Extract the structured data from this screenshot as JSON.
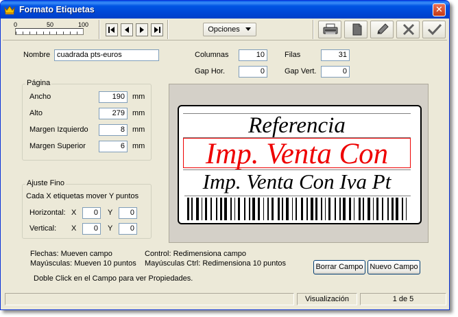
{
  "window": {
    "title": "Formato Etiquetas",
    "close_glyph": "✕",
    "app_icon": "crown-icon"
  },
  "toolbar": {
    "zoom_labels": [
      "0",
      "50",
      "100"
    ],
    "nav_icons": [
      "first-record-icon",
      "previous-record-icon",
      "next-record-icon",
      "last-record-icon"
    ],
    "options_label": "Opciones",
    "tool_icons": [
      "printer-icon",
      "copy-icon",
      "edit-pencil-icon",
      "delete-x-icon",
      "accept-check-icon"
    ]
  },
  "form": {
    "nombre_label": "Nombre",
    "nombre_value": "cuadrada pts-euros",
    "columnas_label": "Columnas",
    "columnas_value": "10",
    "filas_label": "Filas",
    "filas_value": "31",
    "gap_hor_label": "Gap Hor.",
    "gap_hor_value": "0",
    "gap_vert_label": "Gap Vert.",
    "gap_vert_value": "0"
  },
  "pagina": {
    "title": "Página",
    "unit": "mm",
    "rows": [
      {
        "label": "Ancho",
        "value": "190"
      },
      {
        "label": "Alto",
        "value": "279"
      },
      {
        "label": "Margen Izquierdo",
        "value": "8"
      },
      {
        "label": "Margen Superior",
        "value": "6"
      }
    ]
  },
  "ajuste": {
    "title": "Ajuste Fino",
    "description": "Cada  X etiquetas mover Y puntos",
    "horizontal_label": "Horizontal:",
    "vertical_label": "Vertical:",
    "x_label": "X",
    "y_label": "Y",
    "h_x": "0",
    "h_y": "0",
    "v_x": "0",
    "v_y": "0"
  },
  "preview": {
    "field_referencia": "Referencia",
    "field_venta_con": "Imp. Venta Con",
    "field_venta_iva": "Imp. Venta Con Iva Pt"
  },
  "help": {
    "flechas": "Flechas: Mueven campo",
    "control": "Control: Redimensiona campo",
    "mayusculas": "Mayúsculas: Mueven 10 puntos",
    "mayusculas_ctrl": "Mayúsculas Ctrl: Redimensiona 10 puntos",
    "doble_click": "Doble Click en el Campo para ver Propiedades."
  },
  "buttons": {
    "borrar": "Borrar Campo",
    "nuevo": "Nuevo Campo"
  },
  "status": {
    "mode": "Visualización",
    "page": "1 de 5"
  },
  "colors": {
    "title_bar": "#0054e3",
    "accent_red": "#ee0000",
    "dialog_bg": "#ece9d8"
  }
}
